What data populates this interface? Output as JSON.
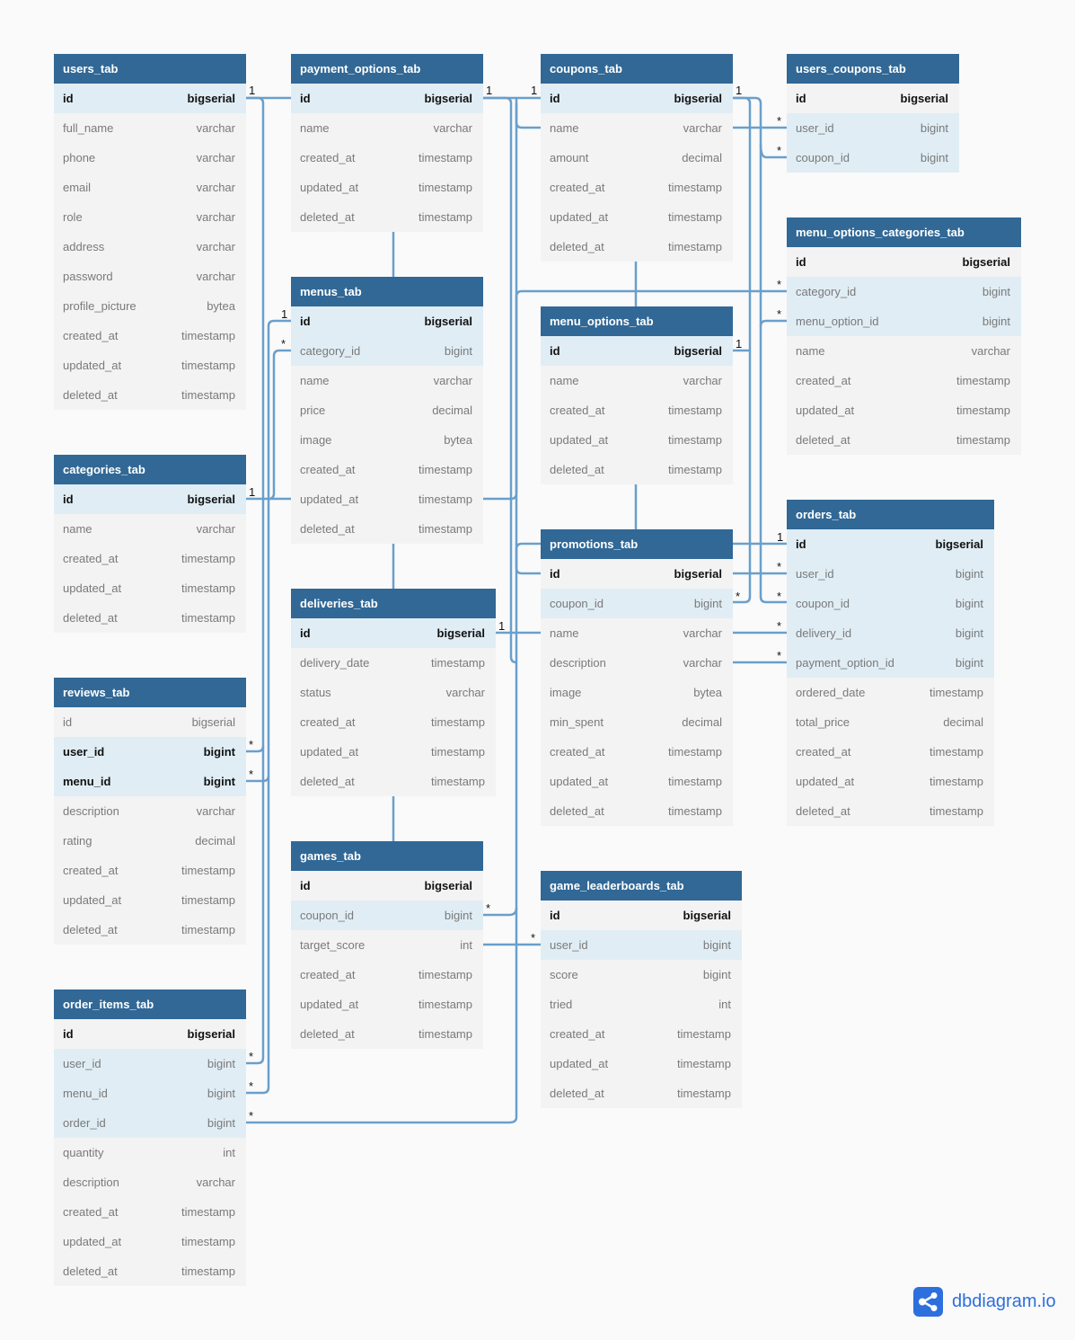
{
  "brand": {
    "name": "dbdiagram.io",
    "icon": "share-nodes-icon",
    "color": "#2d6fdc"
  },
  "colors": {
    "header": "#316896",
    "link": "#6a9fcc",
    "ref_row": "#e0edf5",
    "row": "#f3f3f3"
  },
  "tables": [
    {
      "id": "users_tab",
      "name": "users_tab",
      "rows": [
        {
          "name": "id",
          "type": "bigserial",
          "pk": true,
          "ref": true
        },
        {
          "name": "full_name",
          "type": "varchar"
        },
        {
          "name": "phone",
          "type": "varchar"
        },
        {
          "name": "email",
          "type": "varchar"
        },
        {
          "name": "role",
          "type": "varchar"
        },
        {
          "name": "address",
          "type": "varchar"
        },
        {
          "name": "password",
          "type": "varchar"
        },
        {
          "name": "profile_picture",
          "type": "bytea"
        },
        {
          "name": "created_at",
          "type": "timestamp"
        },
        {
          "name": "updated_at",
          "type": "timestamp"
        },
        {
          "name": "deleted_at",
          "type": "timestamp"
        }
      ]
    },
    {
      "id": "payment_options_tab",
      "name": "payment_options_tab",
      "rows": [
        {
          "name": "id",
          "type": "bigserial",
          "pk": true,
          "ref": true
        },
        {
          "name": "name",
          "type": "varchar"
        },
        {
          "name": "created_at",
          "type": "timestamp"
        },
        {
          "name": "updated_at",
          "type": "timestamp"
        },
        {
          "name": "deleted_at",
          "type": "timestamp"
        }
      ]
    },
    {
      "id": "coupons_tab",
      "name": "coupons_tab",
      "rows": [
        {
          "name": "id",
          "type": "bigserial",
          "pk": true,
          "ref": true
        },
        {
          "name": "name",
          "type": "varchar"
        },
        {
          "name": "amount",
          "type": "decimal"
        },
        {
          "name": "created_at",
          "type": "timestamp"
        },
        {
          "name": "updated_at",
          "type": "timestamp"
        },
        {
          "name": "deleted_at",
          "type": "timestamp"
        }
      ]
    },
    {
      "id": "users_coupons_tab",
      "name": "users_coupons_tab",
      "rows": [
        {
          "name": "id",
          "type": "bigserial",
          "pk": true
        },
        {
          "name": "user_id",
          "type": "bigint",
          "ref": true
        },
        {
          "name": "coupon_id",
          "type": "bigint",
          "ref": true
        }
      ]
    },
    {
      "id": "menu_options_categories_tab",
      "name": "menu_options_categories_tab",
      "rows": [
        {
          "name": "id",
          "type": "bigserial",
          "pk": true
        },
        {
          "name": "category_id",
          "type": "bigint",
          "ref": true
        },
        {
          "name": "menu_option_id",
          "type": "bigint",
          "ref": true
        },
        {
          "name": "name",
          "type": "varchar"
        },
        {
          "name": "created_at",
          "type": "timestamp"
        },
        {
          "name": "updated_at",
          "type": "timestamp"
        },
        {
          "name": "deleted_at",
          "type": "timestamp"
        }
      ]
    },
    {
      "id": "menus_tab",
      "name": "menus_tab",
      "rows": [
        {
          "name": "id",
          "type": "bigserial",
          "pk": true,
          "ref": true
        },
        {
          "name": "category_id",
          "type": "bigint",
          "ref": true
        },
        {
          "name": "name",
          "type": "varchar"
        },
        {
          "name": "price",
          "type": "decimal"
        },
        {
          "name": "image",
          "type": "bytea"
        },
        {
          "name": "created_at",
          "type": "timestamp"
        },
        {
          "name": "updated_at",
          "type": "timestamp"
        },
        {
          "name": "deleted_at",
          "type": "timestamp"
        }
      ]
    },
    {
      "id": "menu_options_tab",
      "name": "menu_options_tab",
      "rows": [
        {
          "name": "id",
          "type": "bigserial",
          "pk": true,
          "ref": true
        },
        {
          "name": "name",
          "type": "varchar"
        },
        {
          "name": "created_at",
          "type": "timestamp"
        },
        {
          "name": "updated_at",
          "type": "timestamp"
        },
        {
          "name": "deleted_at",
          "type": "timestamp"
        }
      ]
    },
    {
      "id": "categories_tab",
      "name": "categories_tab",
      "rows": [
        {
          "name": "id",
          "type": "bigserial",
          "pk": true,
          "ref": true
        },
        {
          "name": "name",
          "type": "varchar"
        },
        {
          "name": "created_at",
          "type": "timestamp"
        },
        {
          "name": "updated_at",
          "type": "timestamp"
        },
        {
          "name": "deleted_at",
          "type": "timestamp"
        }
      ]
    },
    {
      "id": "orders_tab",
      "name": "orders_tab",
      "rows": [
        {
          "name": "id",
          "type": "bigserial",
          "pk": true,
          "ref": true
        },
        {
          "name": "user_id",
          "type": "bigint",
          "ref": true
        },
        {
          "name": "coupon_id",
          "type": "bigint",
          "ref": true
        },
        {
          "name": "delivery_id",
          "type": "bigint",
          "ref": true
        },
        {
          "name": "payment_option_id",
          "type": "bigint",
          "ref": true
        },
        {
          "name": "ordered_date",
          "type": "timestamp"
        },
        {
          "name": "total_price",
          "type": "decimal"
        },
        {
          "name": "created_at",
          "type": "timestamp"
        },
        {
          "name": "updated_at",
          "type": "timestamp"
        },
        {
          "name": "deleted_at",
          "type": "timestamp"
        }
      ]
    },
    {
      "id": "promotions_tab",
      "name": "promotions_tab",
      "rows": [
        {
          "name": "id",
          "type": "bigserial",
          "pk": true
        },
        {
          "name": "coupon_id",
          "type": "bigint",
          "ref": true
        },
        {
          "name": "name",
          "type": "varchar"
        },
        {
          "name": "description",
          "type": "varchar"
        },
        {
          "name": "image",
          "type": "bytea"
        },
        {
          "name": "min_spent",
          "type": "decimal"
        },
        {
          "name": "created_at",
          "type": "timestamp"
        },
        {
          "name": "updated_at",
          "type": "timestamp"
        },
        {
          "name": "deleted_at",
          "type": "timestamp"
        }
      ]
    },
    {
      "id": "deliveries_tab",
      "name": "deliveries_tab",
      "rows": [
        {
          "name": "id",
          "type": "bigserial",
          "pk": true,
          "ref": true
        },
        {
          "name": "delivery_date",
          "type": "timestamp"
        },
        {
          "name": "status",
          "type": "varchar"
        },
        {
          "name": "created_at",
          "type": "timestamp"
        },
        {
          "name": "updated_at",
          "type": "timestamp"
        },
        {
          "name": "deleted_at",
          "type": "timestamp"
        }
      ]
    },
    {
      "id": "reviews_tab",
      "name": "reviews_tab",
      "rows": [
        {
          "name": "id",
          "type": "bigserial"
        },
        {
          "name": "user_id",
          "type": "bigint",
          "pk": true,
          "ref": true
        },
        {
          "name": "menu_id",
          "type": "bigint",
          "pk": true,
          "ref": true
        },
        {
          "name": "description",
          "type": "varchar"
        },
        {
          "name": "rating",
          "type": "decimal"
        },
        {
          "name": "created_at",
          "type": "timestamp"
        },
        {
          "name": "updated_at",
          "type": "timestamp"
        },
        {
          "name": "deleted_at",
          "type": "timestamp"
        }
      ]
    },
    {
      "id": "games_tab",
      "name": "games_tab",
      "rows": [
        {
          "name": "id",
          "type": "bigserial",
          "pk": true
        },
        {
          "name": "coupon_id",
          "type": "bigint",
          "ref": true
        },
        {
          "name": "target_score",
          "type": "int"
        },
        {
          "name": "created_at",
          "type": "timestamp"
        },
        {
          "name": "updated_at",
          "type": "timestamp"
        },
        {
          "name": "deleted_at",
          "type": "timestamp"
        }
      ]
    },
    {
      "id": "game_leaderboards_tab",
      "name": "game_leaderboards_tab",
      "rows": [
        {
          "name": "id",
          "type": "bigserial",
          "pk": true
        },
        {
          "name": "user_id",
          "type": "bigint",
          "ref": true
        },
        {
          "name": "score",
          "type": "bigint"
        },
        {
          "name": "tried",
          "type": "int"
        },
        {
          "name": "created_at",
          "type": "timestamp"
        },
        {
          "name": "updated_at",
          "type": "timestamp"
        },
        {
          "name": "deleted_at",
          "type": "timestamp"
        }
      ]
    },
    {
      "id": "order_items_tab",
      "name": "order_items_tab",
      "rows": [
        {
          "name": "id",
          "type": "bigserial",
          "pk": true
        },
        {
          "name": "user_id",
          "type": "bigint",
          "ref": true
        },
        {
          "name": "menu_id",
          "type": "bigint",
          "ref": true
        },
        {
          "name": "order_id",
          "type": "bigint",
          "ref": true
        },
        {
          "name": "quantity",
          "type": "int"
        },
        {
          "name": "description",
          "type": "varchar"
        },
        {
          "name": "created_at",
          "type": "timestamp"
        },
        {
          "name": "updated_at",
          "type": "timestamp"
        },
        {
          "name": "deleted_at",
          "type": "timestamp"
        }
      ]
    }
  ],
  "relationships": [
    {
      "from": "users_tab.id",
      "to": "reviews_tab.user_id",
      "from_card": "1",
      "to_card": "*"
    },
    {
      "from": "users_tab.id",
      "to": "order_items_tab.user_id",
      "from_card": "1",
      "to_card": "*"
    },
    {
      "from": "users_tab.id",
      "to": "users_coupons_tab.user_id",
      "from_card": "1",
      "to_card": "*"
    },
    {
      "from": "users_tab.id",
      "to": "orders_tab.user_id",
      "from_card": "1",
      "to_card": "*"
    },
    {
      "from": "users_tab.id",
      "to": "game_leaderboards_tab.user_id",
      "from_card": "1",
      "to_card": "*"
    },
    {
      "from": "payment_options_tab.id",
      "to": "orders_tab.payment_option_id",
      "from_card": "1",
      "to_card": "*"
    },
    {
      "from": "coupons_tab.id",
      "to": "users_coupons_tab.coupon_id",
      "from_card": "1",
      "to_card": "*"
    },
    {
      "from": "coupons_tab.id",
      "to": "orders_tab.coupon_id",
      "from_card": "1",
      "to_card": "*"
    },
    {
      "from": "coupons_tab.id",
      "to": "promotions_tab.coupon_id",
      "from_card": "1",
      "to_card": "*"
    },
    {
      "from": "coupons_tab.id",
      "to": "games_tab.coupon_id",
      "from_card": "1",
      "to_card": "*"
    },
    {
      "from": "menus_tab.id",
      "to": "reviews_tab.menu_id",
      "from_card": "1",
      "to_card": "*"
    },
    {
      "from": "menus_tab.id",
      "to": "order_items_tab.menu_id",
      "from_card": "1",
      "to_card": "*"
    },
    {
      "from": "categories_tab.id",
      "to": "menus_tab.category_id",
      "from_card": "1",
      "to_card": "*"
    },
    {
      "from": "categories_tab.id",
      "to": "menu_options_categories_tab.category_id",
      "from_card": "1",
      "to_card": "*"
    },
    {
      "from": "menu_options_tab.id",
      "to": "menu_options_categories_tab.menu_option_id",
      "from_card": "1",
      "to_card": "*"
    },
    {
      "from": "orders_tab.id",
      "to": "order_items_tab.order_id",
      "from_card": "1",
      "to_card": "*"
    },
    {
      "from": "deliveries_tab.id",
      "to": "orders_tab.delivery_id",
      "from_card": "1",
      "to_card": "*"
    }
  ]
}
